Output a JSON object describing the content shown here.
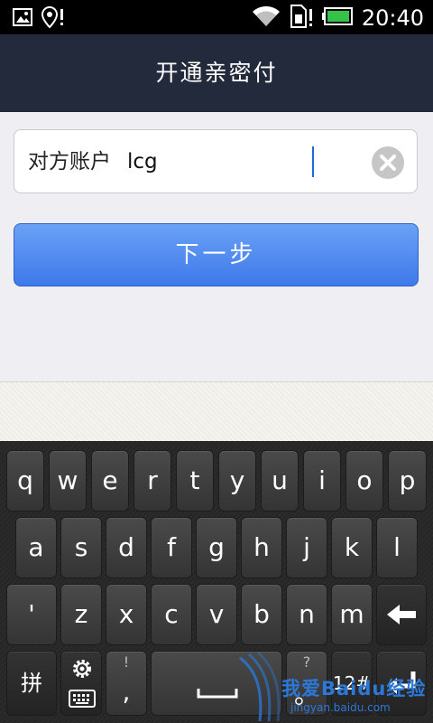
{
  "status_bar": {
    "time": "20:40",
    "icons": [
      "image-icon",
      "location-alert-icon",
      "wifi-icon",
      "sim-alert-icon",
      "battery-icon"
    ]
  },
  "header": {
    "title": "开通亲密付"
  },
  "account": {
    "label": "对方账户",
    "value": "lcg",
    "clear_icon": "clear-icon"
  },
  "next_button": {
    "label": "下一步"
  },
  "keyboard": {
    "row1": [
      "q",
      "w",
      "e",
      "r",
      "t",
      "y",
      "u",
      "i",
      "o",
      "p"
    ],
    "row2": [
      "a",
      "s",
      "d",
      "f",
      "g",
      "h",
      "j",
      "k",
      "l"
    ],
    "row3": [
      "'",
      "z",
      "x",
      "c",
      "v",
      "b",
      "n",
      "m"
    ],
    "row4": {
      "lang": "拼",
      "settings_icon": "gear-icon",
      "keyboard_icon": "keyboard-icon",
      "punct_top": "!",
      "punct_bottom": ",",
      "period_top": "?",
      "period_bottom": "。",
      "symbols": "12#",
      "enter_icon": "enter-icon",
      "backspace_icon": "backspace-icon"
    }
  },
  "watermark": {
    "text": "我爱Baidu经验",
    "sub": "jingyan.baidu.com"
  },
  "colors": {
    "title_bar": "#232a3b",
    "button_blue": "#3e79ea",
    "background": "#eeeef3",
    "keyboard_bg": "#2b2b2b"
  }
}
